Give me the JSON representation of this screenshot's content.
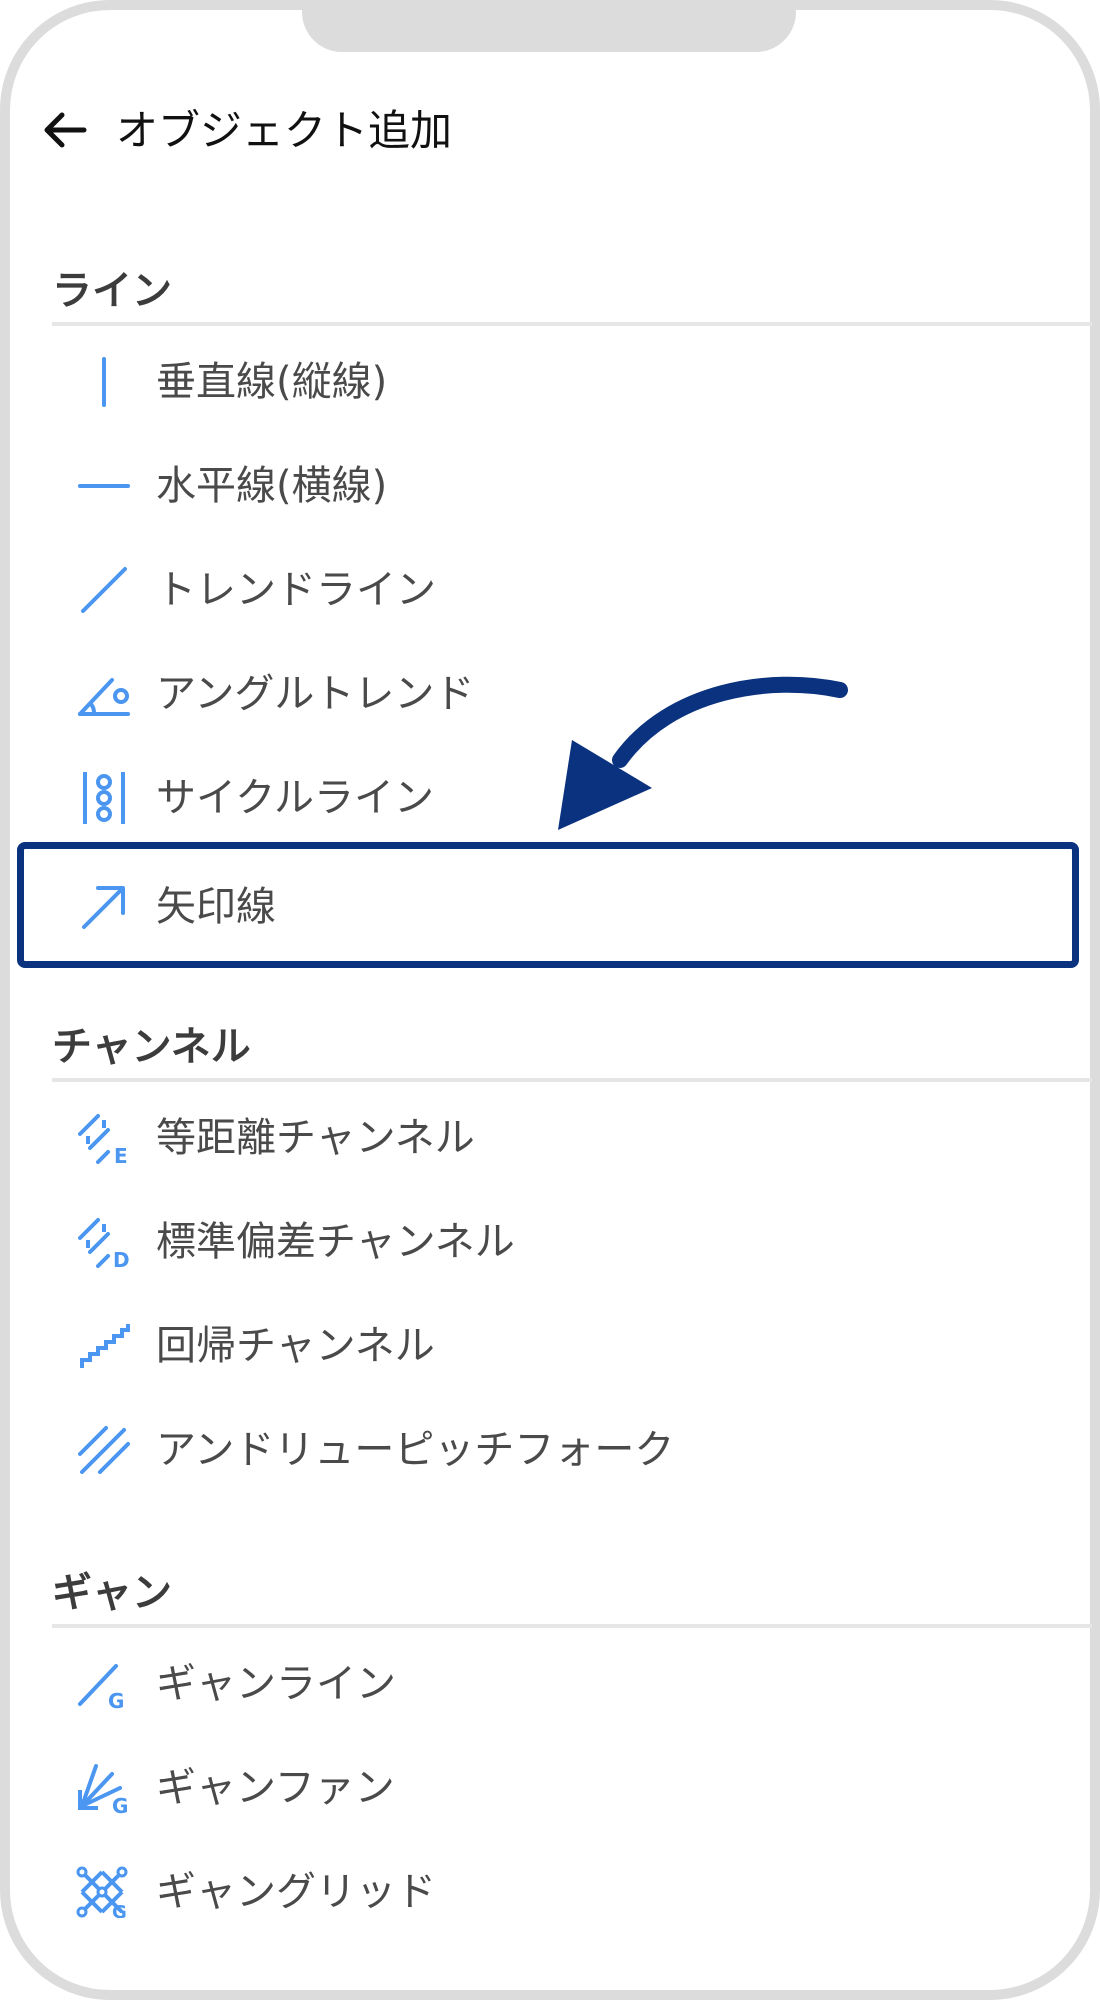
{
  "header": {
    "title": "オブジェクト追加"
  },
  "sections": [
    {
      "title": "ライン",
      "items": [
        {
          "label": "垂直線(縦線)",
          "icon": "vertical-line-icon"
        },
        {
          "label": "水平線(横線)",
          "icon": "horizontal-line-icon"
        },
        {
          "label": "トレンドライン",
          "icon": "trend-line-icon"
        },
        {
          "label": "アングルトレンド",
          "icon": "angle-trend-icon"
        },
        {
          "label": "サイクルライン",
          "icon": "cycle-line-icon"
        },
        {
          "label": "矢印線",
          "icon": "arrow-line-icon"
        }
      ]
    },
    {
      "title": "チャンネル",
      "items": [
        {
          "label": "等距離チャンネル",
          "icon": "equidistant-channel-icon"
        },
        {
          "label": "標準偏差チャンネル",
          "icon": "stddev-channel-icon"
        },
        {
          "label": "回帰チャンネル",
          "icon": "regression-channel-icon"
        },
        {
          "label": "アンドリューピッチフォーク",
          "icon": "andrews-pitchfork-icon"
        }
      ]
    },
    {
      "title": "ギャン",
      "items": [
        {
          "label": "ギャンライン",
          "icon": "gann-line-icon"
        },
        {
          "label": "ギャンファン",
          "icon": "gann-fan-icon"
        },
        {
          "label": "ギャングリッド",
          "icon": "gann-grid-icon"
        }
      ]
    }
  ],
  "colors": {
    "icon": "#4a96f0",
    "highlight": "#0a327e",
    "text": "#4a4a4a",
    "divider": "#e6e6e6"
  }
}
